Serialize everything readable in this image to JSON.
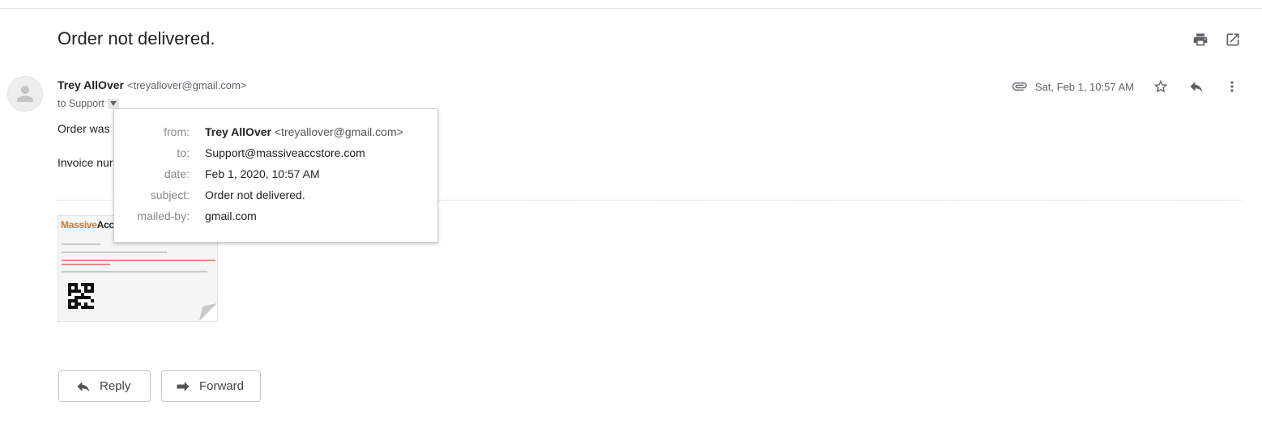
{
  "message": {
    "subject": "Order not delivered.",
    "sender_name": "Trey AllOver",
    "sender_email": "<treyallover@gmail.com>",
    "to_line": "to Support",
    "date": "Sat, Feb 1, 10:57 AM",
    "body_line1": "Order was",
    "body_line2": "Invoice nur"
  },
  "details_popup": {
    "from_label": "from:",
    "from_name": "Trey AllOver",
    "from_email": "<treyallover@gmail.com>",
    "to_label": "to:",
    "to_value": "Support@massiveaccstore.com",
    "date_label": "date:",
    "date_value": "Feb 1, 2020, 10:57 AM",
    "subject_label": "subject:",
    "subject_value": "Order not delivered.",
    "mailedby_label": "mailed-by:",
    "mailedby_value": "gmail.com"
  },
  "attachment": {
    "logo_part1": "Massive",
    "logo_part2": "AccSt"
  },
  "actions": {
    "reply_label": "Reply",
    "forward_label": "Forward"
  },
  "icons": {
    "print": "print-icon",
    "open_new_window": "open-in-new-window-icon",
    "attachment": "paperclip-icon",
    "star": "star-icon",
    "reply": "reply-icon",
    "more": "more-vert-icon"
  }
}
